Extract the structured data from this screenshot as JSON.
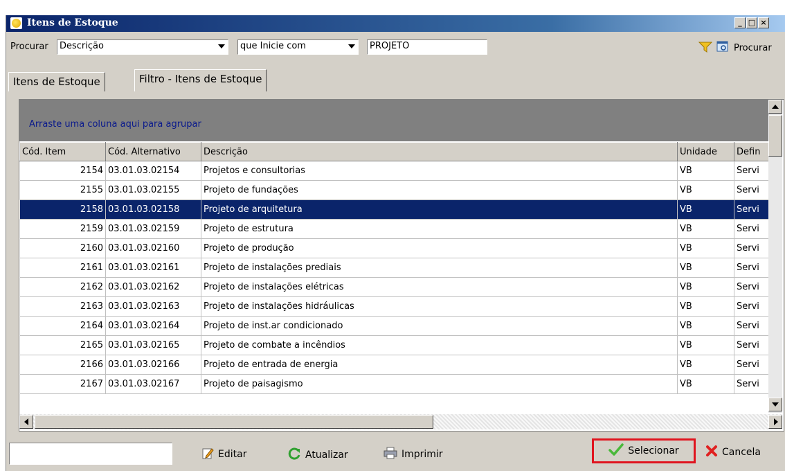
{
  "window": {
    "title": "Itens de Estoque",
    "controls": [
      "_",
      "□",
      "×"
    ]
  },
  "search": {
    "label": "Procurar",
    "field": "Descrição",
    "condition": "que Inicie com",
    "value": "PROJETO",
    "button": "Procurar"
  },
  "tabs": [
    {
      "label": "Itens de Estoque",
      "active": false
    },
    {
      "label": "Filtro - Itens de Estoque",
      "active": true
    }
  ],
  "grid": {
    "group_hint": "Arraste uma coluna aqui para agrupar",
    "columns": [
      "Cód. Item",
      "Cód. Alternativo",
      "Descrição",
      "Unidade",
      "Defin"
    ],
    "rows": [
      [
        "2154",
        "03.01.03.02154",
        "Projetos e consultorias",
        "VB",
        "Servi"
      ],
      [
        "2155",
        "03.01.03.02155",
        "Projeto de fundações",
        "VB",
        "Servi"
      ],
      [
        "2158",
        "03.01.03.02158",
        "Projeto de arquitetura",
        "VB",
        "Servi"
      ],
      [
        "2159",
        "03.01.03.02159",
        "Projeto de estrutura",
        "VB",
        "Servi"
      ],
      [
        "2160",
        "03.01.03.02160",
        "Projeto de produção",
        "VB",
        "Servi"
      ],
      [
        "2161",
        "03.01.03.02161",
        "Projeto de instalações prediais",
        "VB",
        "Servi"
      ],
      [
        "2162",
        "03.01.03.02162",
        "Projeto de instalações elétricas",
        "VB",
        "Servi"
      ],
      [
        "2163",
        "03.01.03.02163",
        "Projeto de instalações hidráulicas",
        "VB",
        "Servi"
      ],
      [
        "2164",
        "03.01.03.02164",
        "Projeto de inst.ar condicionado",
        "VB",
        "Servi"
      ],
      [
        "2165",
        "03.01.03.02165",
        "Projeto de combate a incêndios",
        "VB",
        "Servi"
      ],
      [
        "2166",
        "03.01.03.02166",
        "Projeto de entrada de energia",
        "VB",
        "Servi"
      ],
      [
        "2167",
        "03.01.03.02167",
        "Projeto de paisagismo",
        "VB",
        "Servi"
      ]
    ],
    "selected_index": 2
  },
  "bottom": {
    "input_value": "",
    "edit": "Editar",
    "update": "Atualizar",
    "print": "Imprimir",
    "select": "Selecionar",
    "cancel": "Cancela"
  },
  "colors": {
    "selection": "#0a246a",
    "highlight_border": "#e0141e",
    "title_start": "#0a246a"
  }
}
